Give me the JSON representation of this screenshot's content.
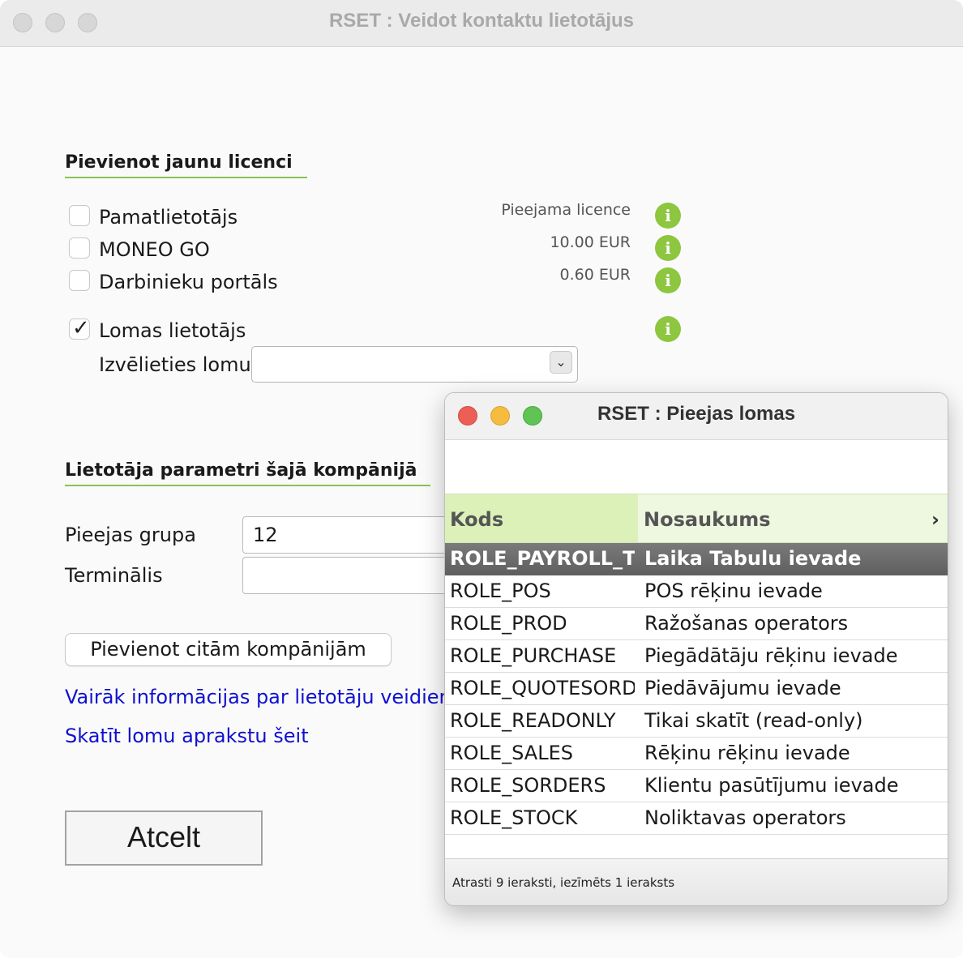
{
  "main_window": {
    "title": "RSET : Veidot kontaktu lietotājus",
    "license_section": {
      "title": "Pievienot jaunu licenci",
      "items": [
        {
          "label": "Pamatlietotājs",
          "checked": false,
          "price": "Pieejama licence"
        },
        {
          "label": "MONEO GO",
          "checked": false,
          "price": "10.00 EUR"
        },
        {
          "label": "Darbinieku portāls",
          "checked": false,
          "price": "0.60 EUR"
        },
        {
          "label": "Lomas lietotājs",
          "checked": true,
          "price": ""
        }
      ],
      "role_select_label": "Izvēlieties lomu",
      "role_select_value": ""
    },
    "params_section": {
      "title": "Lietotāja parametri šajā kompānijā",
      "access_group_label": "Pieejas grupa",
      "access_group_value": "12",
      "terminal_label": "Terminālis",
      "terminal_value": ""
    },
    "add_companies_button": "Pievienot citām kompānijām",
    "links": {
      "user_types": "Vairāk informācijas par lietotāju veidiem",
      "roles_desc": "Skatīt lomu aprakstu šeit"
    },
    "cancel_button": "Atcelt"
  },
  "popup_window": {
    "title": "RSET : Pieejas lomas",
    "columns": {
      "code": "Kods",
      "name": "Nosaukums",
      "more": "›"
    },
    "rows": [
      {
        "code": "ROLE_PAYROLL_TT",
        "name": "Laika Tabulu ievade",
        "selected": true
      },
      {
        "code": "ROLE_POS",
        "name": "POS rēķinu ievade",
        "selected": false
      },
      {
        "code": "ROLE_PROD",
        "name": "Ražošanas operators",
        "selected": false
      },
      {
        "code": "ROLE_PURCHASE",
        "name": "Piegādātāju rēķinu ievade",
        "selected": false
      },
      {
        "code": "ROLE_QUOTESORDERS",
        "name": "Piedāvājumu ievade",
        "selected": false
      },
      {
        "code": "ROLE_READONLY",
        "name": "Tikai skatīt (read-only)",
        "selected": false
      },
      {
        "code": "ROLE_SALES",
        "name": "Rēķinu rēķinu ievade",
        "selected": false
      },
      {
        "code": "ROLE_SORDERS",
        "name": "Klientu pasūtījumu ievade",
        "selected": false
      },
      {
        "code": "ROLE_STOCK",
        "name": "Noliktavas operators",
        "selected": false
      }
    ],
    "status": "Atrasti 9 ieraksti, iezīmēts 1 ieraksts"
  },
  "colors": {
    "accent_green": "#8cc152",
    "info_icon": "#8dc63f",
    "link": "#1010d0",
    "header_green": "#eef7df",
    "selected_row": "#6b6b6b"
  }
}
